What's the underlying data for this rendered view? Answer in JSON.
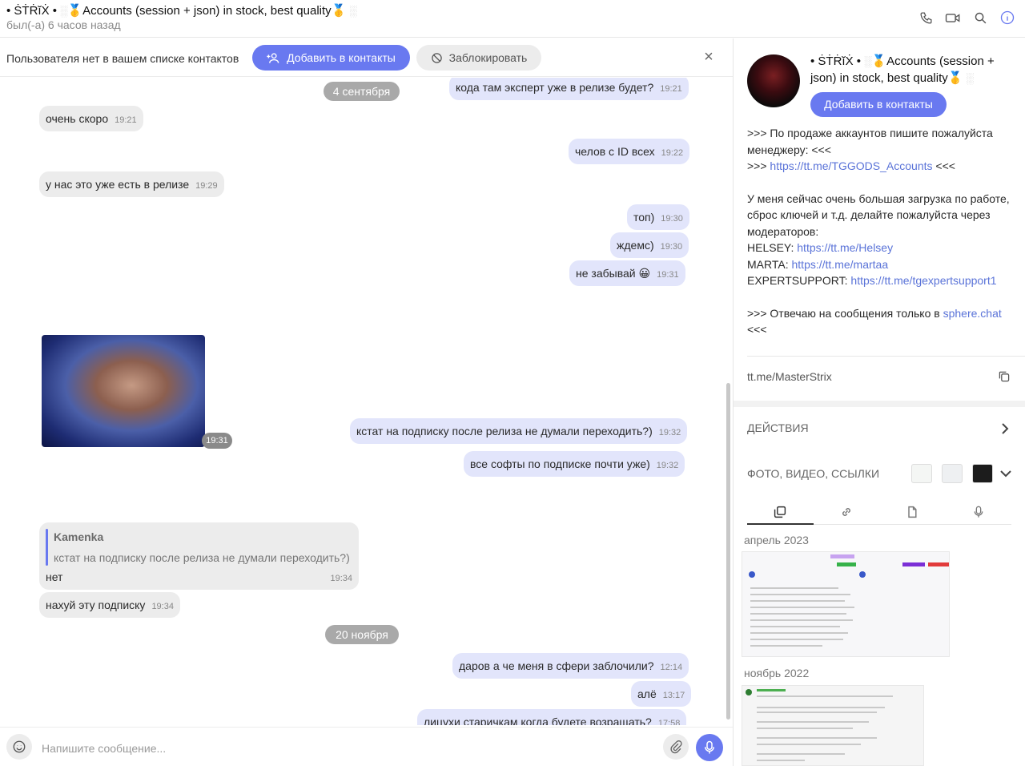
{
  "header": {
    "title_prefix": "• ṠṪṘĭẊ •",
    "title_text": "Accounts (session + json) in stock, best quality",
    "medal_glyph": "🥇",
    "status": "был(-а) 6 часов назад",
    "icons": [
      "phone-icon",
      "video-call-icon",
      "search-icon",
      "info-icon"
    ]
  },
  "notice": {
    "text": "Пользователя нет в вашем списке контактов",
    "add_label": "Добавить в контакты",
    "block_label": "Заблокировать",
    "close_glyph": "×"
  },
  "messages": [
    {
      "dir": "out",
      "text": "кода там эксперт уже в релизе будет?",
      "time": "19:21"
    },
    {
      "dir": "date",
      "text": "4 сентября"
    },
    {
      "dir": "in",
      "text": "очень скоро",
      "time": "19:21"
    },
    {
      "dir": "out",
      "text": "челов с ID всех",
      "time": "19:22"
    },
    {
      "dir": "in",
      "text": "у нас это уже есть в релизе",
      "time": "19:29"
    },
    {
      "dir": "out",
      "text": "топ)",
      "time": "19:30"
    },
    {
      "dir": "out",
      "text": "ждемс)",
      "time": "19:30"
    },
    {
      "dir": "out",
      "text": "не забывай 😀",
      "time": "19:31"
    },
    {
      "dir": "sticker",
      "time": "19:31"
    },
    {
      "dir": "out",
      "text": "кстат на подписку после релиза не думали переходить?)",
      "time": "19:32"
    },
    {
      "dir": "out",
      "text": "все софты по подписке почти уже)",
      "time": "19:32"
    },
    {
      "dir": "reply",
      "author": "Kamenka",
      "quote": "кстат на подписку после релиза не думали переходить?)",
      "text": "нет",
      "time": "19:34"
    },
    {
      "dir": "in",
      "text": "нахуй эту подписку",
      "time": "19:34"
    },
    {
      "dir": "date",
      "text": "20 ноября"
    },
    {
      "dir": "out",
      "text": "даров а че меня в сфери заблочили?",
      "time": "12:14"
    },
    {
      "dir": "out",
      "text": "алё",
      "time": "13:17"
    },
    {
      "dir": "out",
      "text": "лицухи старичкам когда будете возращать?",
      "time": "17:58"
    }
  ],
  "composer": {
    "placeholder": "Напишите сообщение..."
  },
  "profile": {
    "name_prefix": "• ṠṪṘĭẊ •",
    "name_text": "Accounts (session + json) in stock, best quality",
    "add_label": "Добавить в контакты",
    "bio": {
      "l1": ">>> По продаже аккаунтов пишите пожалуйста менеджеру: <<<",
      "l2_pre": ">>> ",
      "l2_link": "https://tt.me/TGGODS_Accounts",
      "l2_post": " <<<",
      "p2": "У меня сейчас очень большая загрузка по работе, сброс ключей и т.д. делайте пожалуйста через модераторов:",
      "h_label": "HELSEY: ",
      "h_link": "https://tt.me/Helsey",
      "m_label": "MARTA: ",
      "m_link": "https://tt.me/martaa",
      "e_label": "EXPERTSUPPORT: ",
      "e_link": "https://tt.me/tgexpertsupport1",
      "l3_pre": ">>> Отвечаю на сообщения только в ",
      "l3_link": "sphere.chat",
      "l3_post": " <<<"
    },
    "username": "tt.me/MasterStrix",
    "actions_label": "ДЕЙСТВИЯ",
    "media_label": "ФОТО, ВИДЕО, ССЫЛКИ",
    "tabs": [
      "media-tab",
      "links-tab",
      "files-tab",
      "voice-tab"
    ],
    "months": [
      "апрель 2023",
      "ноябрь 2022"
    ]
  },
  "colors": {
    "accent": "#6979f0",
    "bubble_in": "#ececec",
    "bubble_out": "#e2e5fb",
    "link": "#5a73d8"
  }
}
